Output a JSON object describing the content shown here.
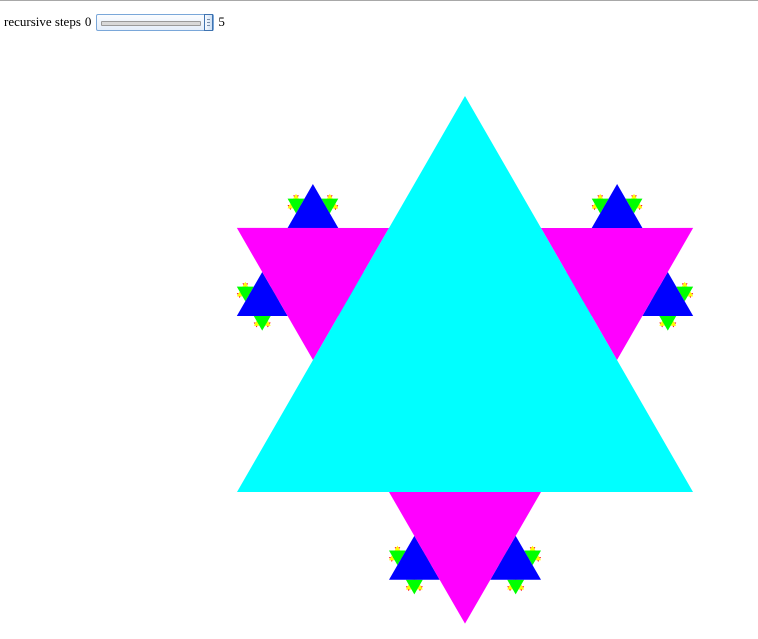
{
  "controls": {
    "label": "recursive steps",
    "min_label": "0",
    "max_label": "5",
    "slider_value": 5
  },
  "fractal": {
    "colors": [
      "#00ffff",
      "#ff00ff",
      "#0000ff",
      "#00ff00",
      "#ffff00",
      "#ff0000"
    ]
  }
}
